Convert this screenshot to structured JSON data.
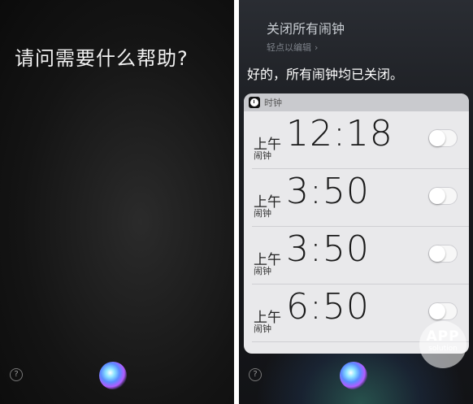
{
  "left": {
    "prompt": "请问需要什么帮助?",
    "help_symbol": "?"
  },
  "right": {
    "query": "关闭所有闹钟",
    "edit_hint": "轻点以编辑",
    "edit_chevron": "›",
    "response": "好的，所有闹钟均已关闭。",
    "card": {
      "app_name": "时钟",
      "icon": "clock-icon",
      "alarms": [
        {
          "ampm": "上午",
          "time": "12:18",
          "label": "闹钟",
          "enabled": false
        },
        {
          "ampm": "上午",
          "time": "3:50",
          "label": "闹钟",
          "enabled": false
        },
        {
          "ampm": "上午",
          "time": "3:50",
          "label": "闹钟",
          "enabled": false
        },
        {
          "ampm": "上午",
          "time": "6:50",
          "label": "闹钟",
          "enabled": false
        }
      ]
    },
    "help_symbol": "?",
    "watermark": {
      "line1": "APP",
      "line2": "solution"
    }
  }
}
